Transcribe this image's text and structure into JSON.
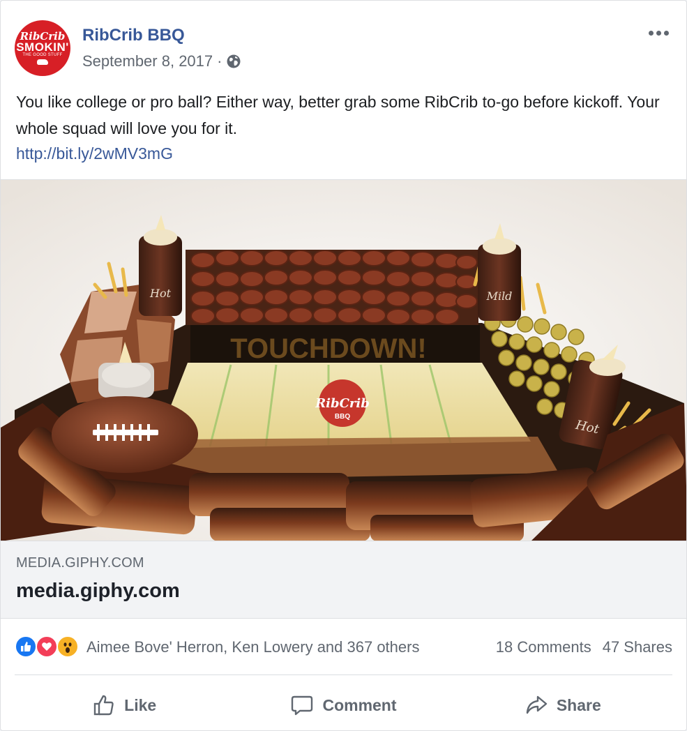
{
  "post": {
    "page_name": "RibCrib BBQ",
    "date": "September 8, 2017",
    "separator": "·",
    "privacy_icon": "globe-icon",
    "avatar": {
      "line1": "RibCrib",
      "line2": "SMOKIN'",
      "line3": "THE GOOD STUFF"
    },
    "text": "You like college or pro ball? Either way, better grab some RibCrib to-go before kickoff. Your whole squad will love you for it.",
    "link_text": "http://bit.ly/2wMV3mG"
  },
  "media_image": {
    "banner_text": "TOUCHDOWN!",
    "field_logo": "RibCrib",
    "field_logo_sub": "BBQ",
    "bottle_labels": [
      "Hot",
      "Mild",
      "Hot"
    ]
  },
  "link_preview": {
    "domain": "MEDIA.GIPHY.COM",
    "title": "media.giphy.com"
  },
  "reactions": {
    "names": "Aimee Bove' Herron, Ken Lowery and 367 others",
    "comments": "18 Comments",
    "shares": "47 Shares"
  },
  "actions": {
    "like": "Like",
    "comment": "Comment",
    "share": "Share"
  },
  "colors": {
    "link_blue": "#385898",
    "brand_red": "#d71f26",
    "like_blue": "#1877f2",
    "love_red": "#f33e58",
    "wow_yellow": "#f7b125"
  }
}
